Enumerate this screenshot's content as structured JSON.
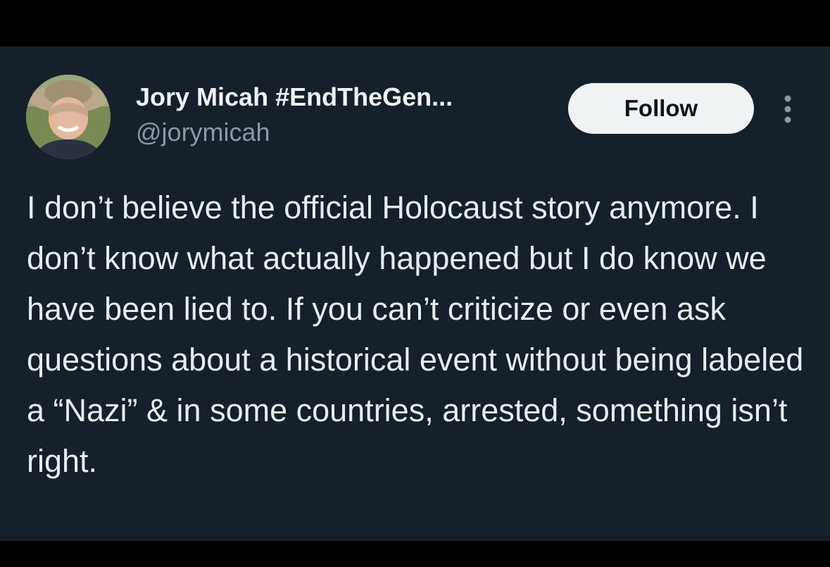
{
  "tweet": {
    "author": {
      "display_name": "Jory Micah #EndTheGen...",
      "handle": "@jorymicah",
      "avatar_icon": "user-avatar-photo"
    },
    "follow_label": "Follow",
    "more_icon": "vertical-ellipsis-icon",
    "text": "I don’t believe the official Holocaust story anymore. I don’t know what actually happened but I do know we have been lied to. If you can’t criticize or even ask questions about a historical event without being labeled a “Nazi” & in some countries, arrested, something isn’t right."
  },
  "colors": {
    "background": "#15202b",
    "frame": "#000000",
    "primary_text": "#e8ecef",
    "secondary_text": "#8b98a5",
    "follow_button_bg": "#eff3f4",
    "follow_button_text": "#0f1419"
  }
}
